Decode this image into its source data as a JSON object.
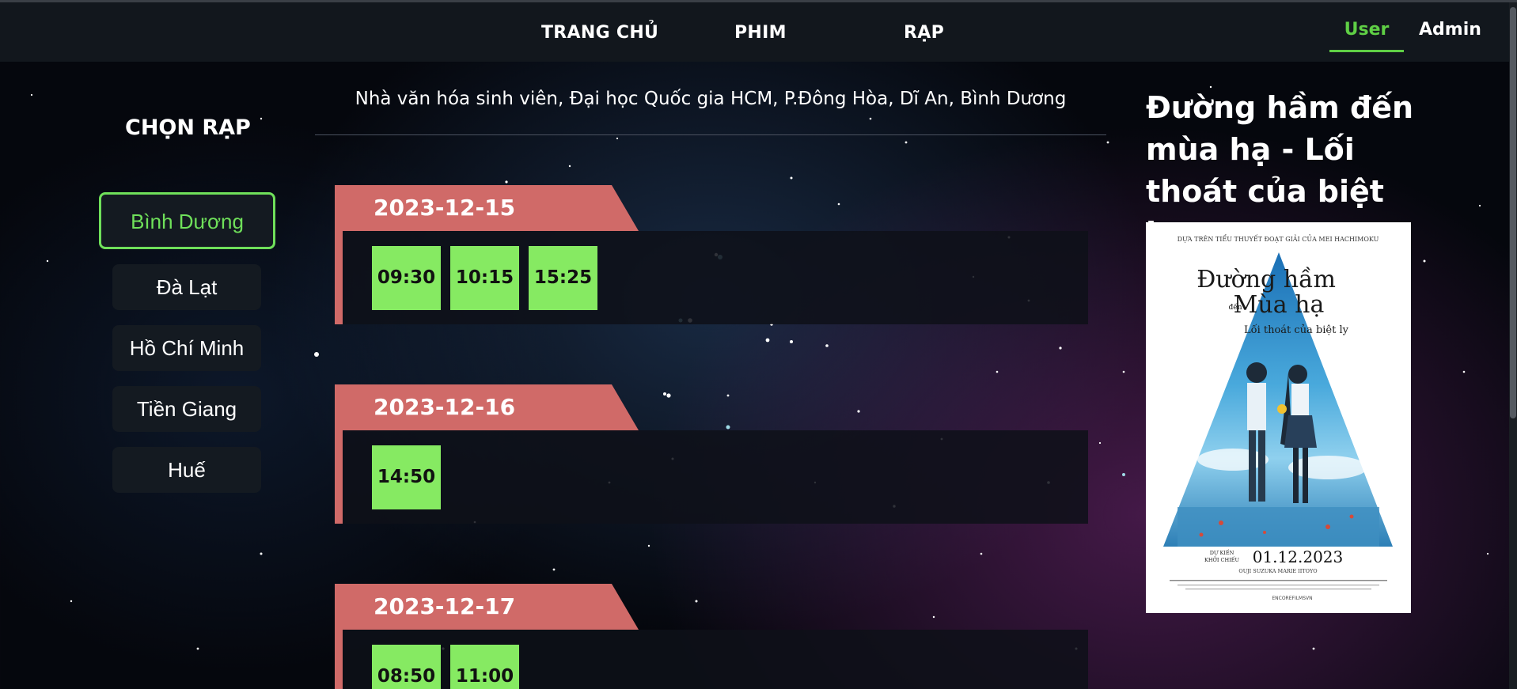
{
  "nav": {
    "home": "TRANG CHỦ",
    "films": "PHIM",
    "cinemas": "RẠP",
    "user": "User",
    "admin": "Admin"
  },
  "sidebar": {
    "title": "CHỌN RẠP",
    "cities": [
      "Bình Dương",
      "Đà Lạt",
      "Hồ Chí Minh",
      "Tiền Giang",
      "Huế"
    ],
    "selected": "Bình Dương"
  },
  "address": "Nhà văn hóa sinh viên, Đại học Quốc gia HCM, P.Đông Hòa, Dĩ An, Bình Dương",
  "schedule": [
    {
      "date": "2023-12-15",
      "times": [
        "09:30",
        "10:15",
        "15:25"
      ]
    },
    {
      "date": "2023-12-16",
      "times": [
        "14:50"
      ]
    },
    {
      "date": "2023-12-17",
      "times": [
        "08:50",
        "11:00"
      ]
    }
  ],
  "movie": {
    "title": "Đường hầm đến mùa hạ - Lối thoát của biệt ly",
    "poster": {
      "top_text": "DỰA TRÊN TIỂU THUYẾT ĐOẠT GIẢI CỦA MEI HACHIMOKU",
      "title_line1": "Đường hầm",
      "title_small": "đến",
      "title_line2": "Mùa hạ",
      "subtitle": "Lối thoát của biệt ly",
      "release_label_1": "DỰ KIẾN",
      "release_label_2": "KHỞI CHIẾU",
      "release_date": "01.12.2023",
      "cast": "OUJI SUZUKA   MARIE IITOYO",
      "social": "ENCOREFILMSVN"
    }
  },
  "colors": {
    "accent_green": "#6fe05a",
    "time_green": "#86ea62",
    "date_tab": "#d06a68",
    "nav_bg": "#12171d"
  }
}
